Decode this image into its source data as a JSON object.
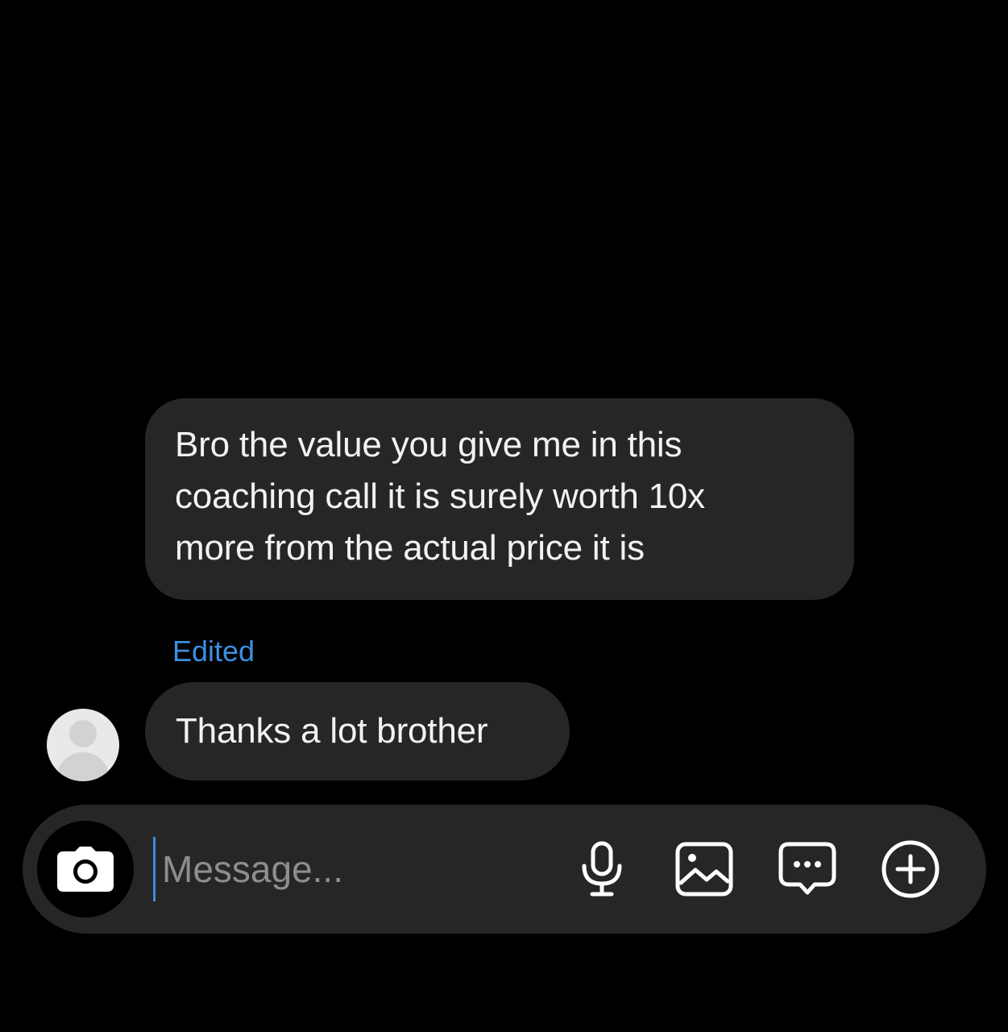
{
  "conversation": {
    "messages": [
      {
        "lines": [
          "Bro the value you give me in this",
          "coaching call it is surely worth 10x",
          "more from the actual price it is"
        ],
        "status": "Edited"
      },
      {
        "text": "Thanks a lot brother"
      }
    ]
  },
  "composer": {
    "placeholder": "Message...",
    "value": "",
    "icons": {
      "camera": "camera-icon",
      "microphone": "microphone-icon",
      "gallery": "gallery-icon",
      "sticker": "sticker-icon",
      "add": "plus-circle-icon"
    }
  },
  "colors": {
    "background": "#000000",
    "bubble": "#262626",
    "text": "#f2f2f2",
    "accent": "#3b8fe0"
  }
}
